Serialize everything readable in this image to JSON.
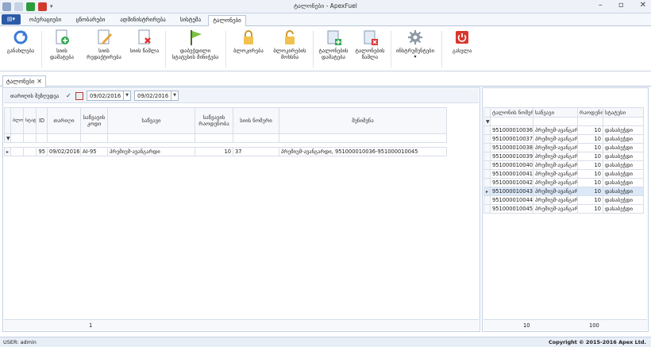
{
  "window": {
    "title": "ტალონები - ApexFuel"
  },
  "tabs": [
    "ოპერაციები",
    "ცნობარები",
    "ადმინისტრირება",
    "სისტემა",
    "ტალონები"
  ],
  "ribbon": {
    "buttons": [
      {
        "label": "განახლება"
      },
      {
        "label": "სიის დამატება"
      },
      {
        "label": "სიის რედაქტირება"
      },
      {
        "label": "სიის წაშლა"
      },
      {
        "label": "დაბეჭდილი სტატუსის მინიჭება"
      },
      {
        "label": "ბლოკირება"
      },
      {
        "label": "ბლოკირების მოხსნა"
      },
      {
        "label": "ტალონების დამატება"
      },
      {
        "label": "ტალონების წაშლა"
      },
      {
        "label": "ინსტრუმენტები"
      },
      {
        "label": "გასვლა"
      }
    ]
  },
  "doc_tab": {
    "label": "ტალონები"
  },
  "filter": {
    "label": "თარიღის შეზღუდვა",
    "date_from": "09/02/2016",
    "date_to": "09/02/2016"
  },
  "left_grid": {
    "headers": [
      "ბლოკირებული",
      "სტატუსი",
      "ID",
      "თარიღი",
      "საწვავის კოდი",
      "საწვავი",
      "საწვავის რაოდენობა",
      "სიის ნომერი",
      "შენიშვნა"
    ],
    "rows": [
      {
        "id": "95",
        "date": "09/02/2016",
        "fuel_code": "AI-95",
        "fuel": "პრემიუმ-ავანგარდი",
        "qty": "10",
        "list_no": "37",
        "note": "პრემიუმ-ავანგარდი, 951000010036-951000010045"
      }
    ],
    "footer_count": "1"
  },
  "right_grid": {
    "headers": [
      "ტალონის ნომერი",
      "საწვავი",
      "რაოდენობა",
      "სტატუსი"
    ],
    "rows": [
      {
        "no": "951000010036",
        "fuel": "პრემიუმ-ავანგარდი",
        "qty": "10",
        "status": "დასაბეჭდი"
      },
      {
        "no": "951000010037",
        "fuel": "პრემიუმ-ავანგარდი",
        "qty": "10",
        "status": "დასაბეჭდი"
      },
      {
        "no": "951000010038",
        "fuel": "პრემიუმ-ავანგარდი",
        "qty": "10",
        "status": "დასაბეჭდი"
      },
      {
        "no": "951000010039",
        "fuel": "პრემიუმ-ავანგარდი",
        "qty": "10",
        "status": "დასაბეჭდი"
      },
      {
        "no": "951000010040",
        "fuel": "პრემიუმ-ავანგარდი",
        "qty": "10",
        "status": "დასაბეჭდი"
      },
      {
        "no": "951000010041",
        "fuel": "პრემიუმ-ავანგარდი",
        "qty": "10",
        "status": "დასაბეჭდი"
      },
      {
        "no": "951000010042",
        "fuel": "პრემიუმ-ავანგარდი",
        "qty": "10",
        "status": "დასაბეჭდი"
      },
      {
        "no": "951000010043",
        "fuel": "პრემიუმ-ავანგარდი",
        "qty": "10",
        "status": "დასაბეჭდი"
      },
      {
        "no": "951000010044",
        "fuel": "პრემიუმ-ავანგარდი",
        "qty": "10",
        "status": "დასაბეჭდი"
      },
      {
        "no": "951000010045",
        "fuel": "პრემიუმ-ავანგარდი",
        "qty": "10",
        "status": "დასაბეჭდი"
      }
    ],
    "footer_count": "10",
    "footer_total": "100"
  },
  "status": {
    "user": "USER: admin",
    "copyright": "Copyright © 2015-2016 Apex Ltd."
  }
}
